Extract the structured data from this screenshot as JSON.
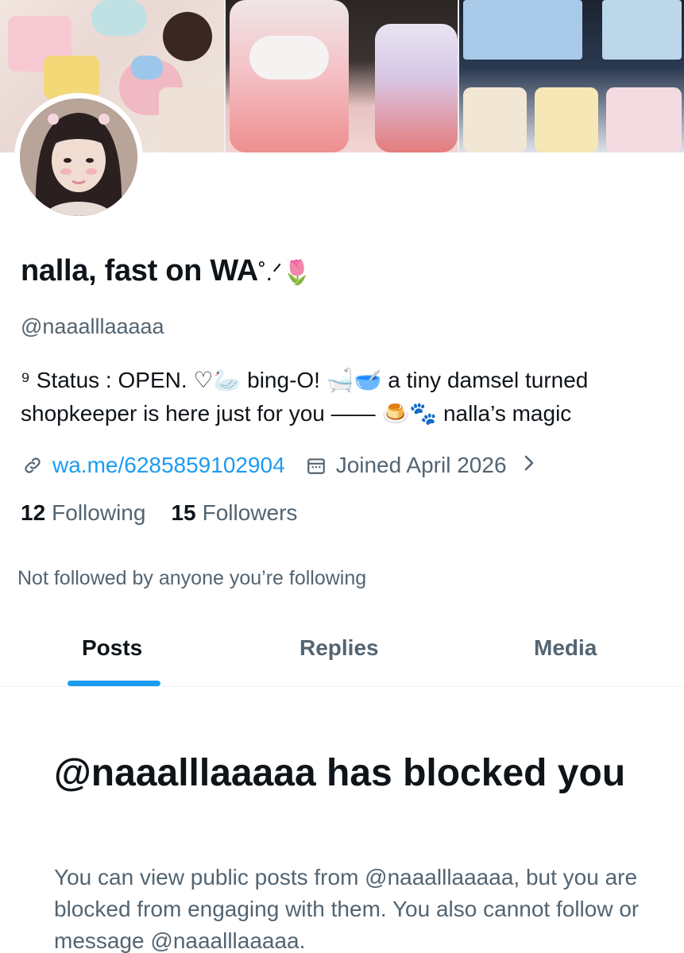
{
  "profile": {
    "display_name": "nalla, fast on WA",
    "display_name_emoji": "˚.ᐟ🌷",
    "handle": "@naaalllaaaaa",
    "bio": "⁹ Status : OPEN. ♡🦢 bing-O! 🛁🥣 a tiny damsel turned shopkeeper is here just for you —— 🍮🐾 nalla’s magic",
    "website": "wa.me/6285859102904",
    "joined": "Joined April 2026",
    "following_count": "12",
    "following_label": "Following",
    "followers_count": "15",
    "followers_label": "Followers",
    "not_followed_text": "Not followed by anyone you’re following"
  },
  "icons": {
    "link": "link-icon",
    "calendar": "calendar-icon",
    "chevron": "chevron-right-icon"
  },
  "tabs": [
    {
      "label": "Posts",
      "active": true
    },
    {
      "label": "Replies",
      "active": false
    },
    {
      "label": "Media",
      "active": false
    }
  ],
  "blocked": {
    "title": "@naaalllaaaaa has blocked you",
    "description": "You can view public posts from @naaalllaaaaa, but you are blocked from engaging with them. You also cannot follow or message @naaalllaaaaa."
  },
  "colors": {
    "accent": "#1d9bf0",
    "text_primary": "#0f1419",
    "text_secondary": "#536471"
  }
}
